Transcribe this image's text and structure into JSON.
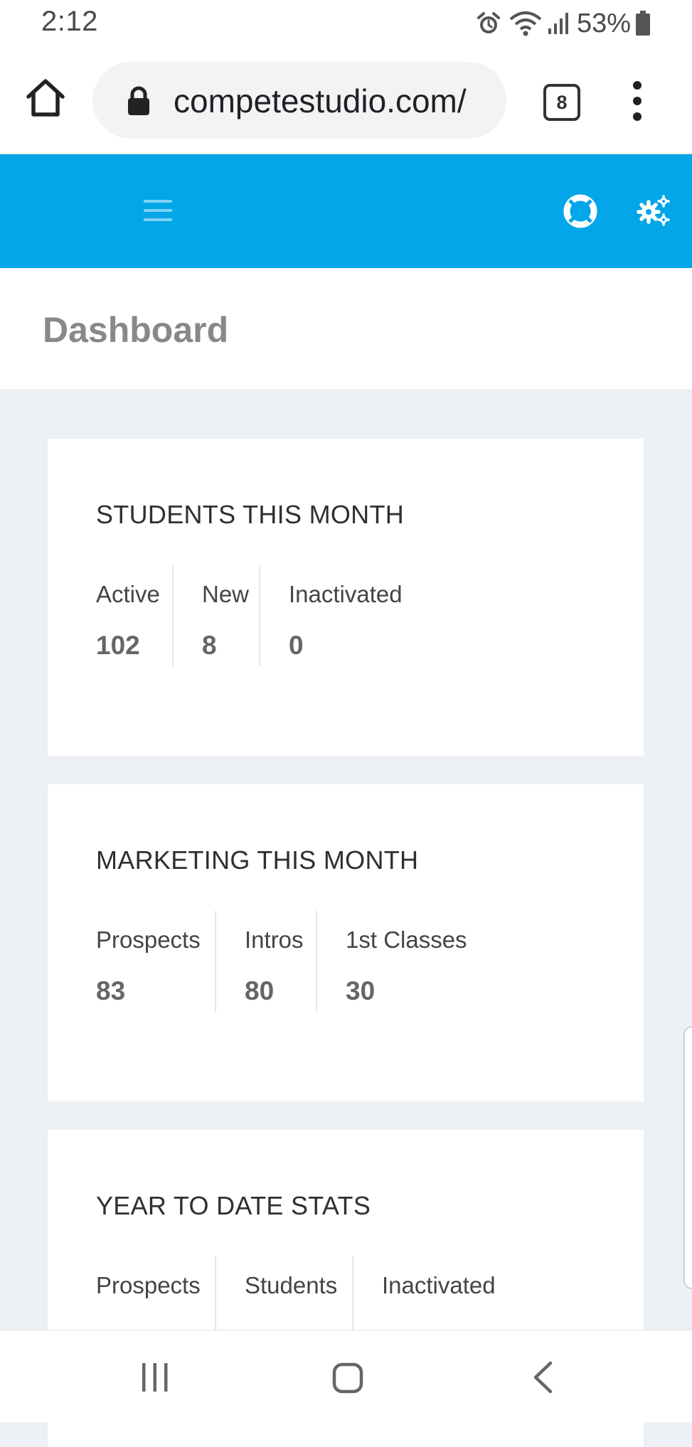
{
  "status_bar": {
    "time": "2:12",
    "battery_percent": "53%",
    "icons": [
      "alarm-icon",
      "wifi-icon",
      "signal-icon",
      "battery-icon"
    ]
  },
  "browser": {
    "url": "competestudio.com/",
    "tab_count": "8",
    "icons": [
      "home-icon",
      "lock-icon",
      "overflow-menu-icon"
    ]
  },
  "app_header": {
    "background_color": "#03a6e8",
    "icons": [
      "hamburger-menu-icon",
      "lifebuoy-icon",
      "gears-icon"
    ]
  },
  "page": {
    "title": "Dashboard"
  },
  "cards": [
    {
      "title": "STUDENTS THIS MONTH",
      "stats": [
        {
          "label": "Active",
          "value": "102"
        },
        {
          "label": "New",
          "value": "8"
        },
        {
          "label": "Inactivated",
          "value": "0"
        }
      ]
    },
    {
      "title": "MARKETING THIS MONTH",
      "stats": [
        {
          "label": "Prospects",
          "value": "83"
        },
        {
          "label": "Intros",
          "value": "80"
        },
        {
          "label": "1st Classes",
          "value": "30"
        }
      ]
    },
    {
      "title": "YEAR TO DATE STATS",
      "stats": [
        {
          "label": "Prospects"
        },
        {
          "label": "Students"
        },
        {
          "label": "Inactivated"
        }
      ]
    }
  ],
  "nav_bar": {
    "icons": [
      "recent-apps-icon",
      "home-icon",
      "back-icon"
    ]
  }
}
